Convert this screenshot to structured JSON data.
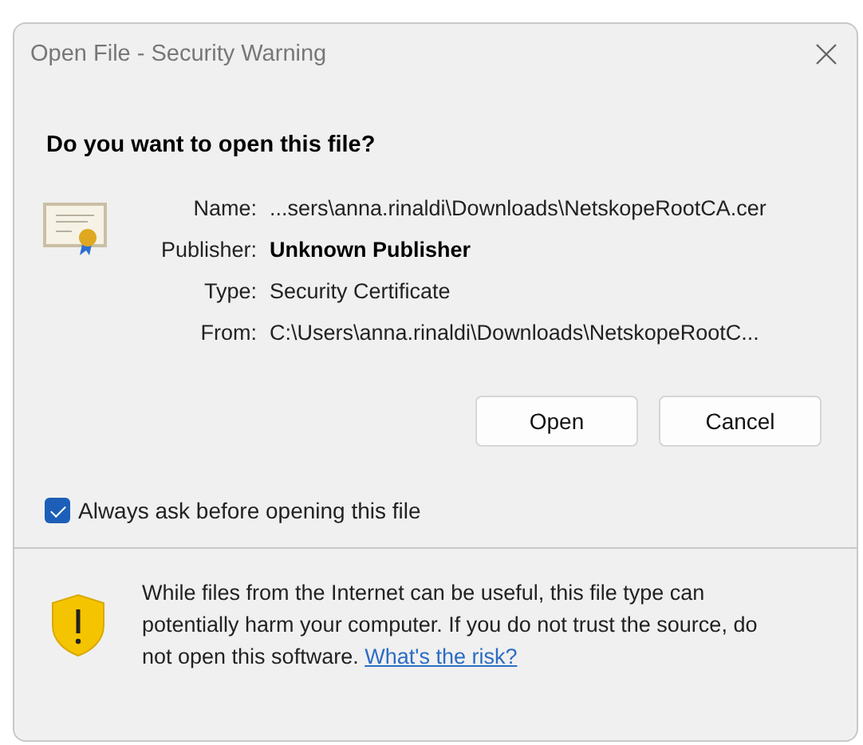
{
  "window": {
    "title": "Open File - Security Warning"
  },
  "heading": "Do you want to open this file?",
  "details": [
    {
      "label": "Name:",
      "value": "...sers\\anna.rinaldi\\Downloads\\NetskopeRootCA.cer",
      "emphasis": false
    },
    {
      "label": "Publisher:",
      "value": "Unknown Publisher",
      "emphasis": true
    },
    {
      "label": "Type:",
      "value": "Security Certificate",
      "emphasis": false
    },
    {
      "label": "From:",
      "value": "C:\\Users\\anna.rinaldi\\Downloads\\NetskopeRootC...",
      "emphasis": false
    }
  ],
  "buttons": [
    "Open",
    "Cancel"
  ],
  "checkbox": {
    "label": "Always ask before opening this file",
    "checked": true
  },
  "warning": {
    "text": "While files from the Internet can be useful, this file type can potentially harm your computer. If you do not trust the source, do not open this software.",
    "link": "What's the risk?"
  }
}
